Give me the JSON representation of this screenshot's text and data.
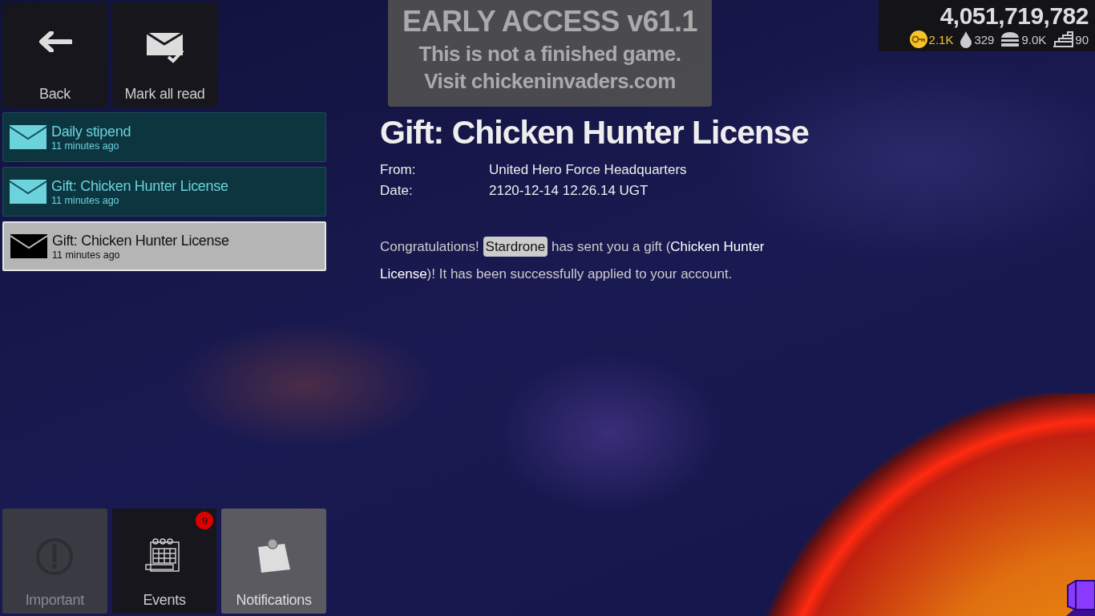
{
  "top_buttons": [
    {
      "kind": "back",
      "label": "Back"
    },
    {
      "kind": "mark_read",
      "label": "Mark all read"
    }
  ],
  "messages": [
    {
      "title": "Daily stipend",
      "time": "11 minutes ago",
      "read": false,
      "selected": false
    },
    {
      "title": "Gift: Chicken Hunter License",
      "time": "11 minutes ago",
      "read": false,
      "selected": false
    },
    {
      "title": "Gift: Chicken Hunter License",
      "time": "11 minutes ago",
      "read": true,
      "selected": true
    }
  ],
  "bottom_tabs": [
    {
      "kind": "important",
      "label": "Important",
      "disabled": true,
      "selected": false
    },
    {
      "kind": "events",
      "label": "Events",
      "disabled": false,
      "selected": false,
      "badge": "9"
    },
    {
      "kind": "notifications",
      "label": "Notifications",
      "disabled": false,
      "selected": true
    }
  ],
  "banner": {
    "title": "EARLY ACCESS v61.1",
    "lines": [
      "This is not a finished game.",
      "Visit chickeninvaders.com"
    ]
  },
  "message": {
    "title": "Gift: Chicken Hunter License",
    "fields": [
      {
        "label": "From:",
        "value": "United Hero Force Headquarters"
      },
      {
        "label": "Date:",
        "value": "2120-12-14 12.26.14 UGT"
      }
    ],
    "body_before": "Congratulations!",
    "sender": "Stardrone",
    "body_after": "has sent you a gift (**Chicken Hunter License**)! It has been successfully applied to your account."
  },
  "resources": {
    "score": "4,051,719,782",
    "items": [
      {
        "kind": "key",
        "value": "2.1K"
      },
      {
        "kind": "drop",
        "value": "329"
      },
      {
        "kind": "burger",
        "value": "9.0K"
      },
      {
        "kind": "stairs",
        "value": "90"
      }
    ]
  }
}
